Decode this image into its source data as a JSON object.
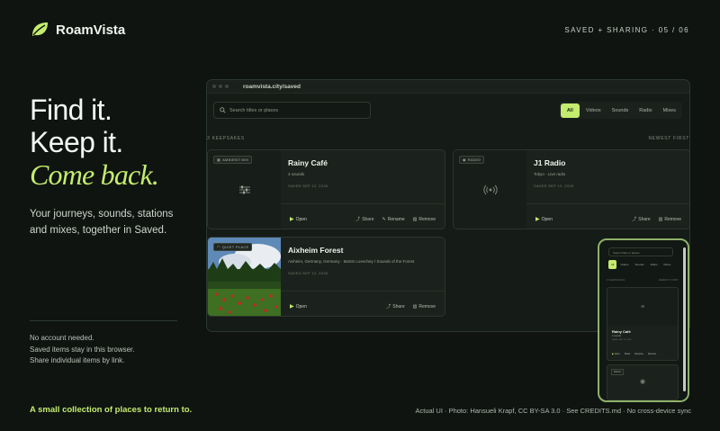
{
  "brand": {
    "name": "RoamVista",
    "color": "#c4ec6e"
  },
  "header": {
    "step": "SAVED + SHARING · 05 / 06"
  },
  "hero": {
    "line1": "Find it.",
    "line2": "Keep it.",
    "line3": "Come back."
  },
  "subtitle": "Your journeys, sounds, stations and mixes, together in Saved.",
  "notes": [
    "No account needed.",
    "Saved items stay in this browser.",
    "Share individual items by link."
  ],
  "tagline": "A small collection of places to return to.",
  "credit": "Actual UI · Photo: Hansueli Krapf, CC BY-SA 3.0 · See CREDITS.md · No cross-device sync",
  "browser": {
    "url": "roamvista.city/saved",
    "search_placeholder": "Search titles or places",
    "filters": [
      "All",
      "Videos",
      "Sounds",
      "Radio",
      "Mixes"
    ],
    "active_filter": "All",
    "count_label": "3 KEEPSAKES",
    "sort_label": "NEWEST FIRST"
  },
  "cards": [
    {
      "badge": "AMBIENT MIX",
      "title": "Rainy Café",
      "meta": "4 sounds",
      "date": "SAVED SEP 12, 2026",
      "open": "Open",
      "actions": [
        "Share",
        "Rename",
        "Remove"
      ]
    },
    {
      "badge": "RADIO",
      "title": "J1 Radio",
      "meta": "Tokyo · Live radio",
      "date": "SAVED SEP 12, 2026",
      "open": "Open",
      "actions": [
        "Share",
        "Remove"
      ]
    },
    {
      "badge": "QUIET PLACE",
      "title": "Aixheim Forest",
      "meta": "Aixheim, Germany, Germany · Martin Loeschey / Sounds of the Forest",
      "date": "SAVED SEP 12, 2026",
      "open": "Open",
      "actions": [
        "Share",
        "Remove"
      ]
    }
  ],
  "phone": {
    "search_placeholder": "Search titles or places",
    "filters": [
      "All",
      "Videos",
      "Sounds",
      "Radio",
      "Mixes"
    ],
    "count_label": "3 KEEPSAKES",
    "sort_label": "NEWEST FIRST",
    "card_title": "Rainy Café",
    "card_meta": "4 sounds",
    "card_date": "SAVED SEP 12, 2026",
    "open": "Open",
    "actions": [
      "Share",
      "Rename",
      "Remove"
    ],
    "badge2": "RADIO"
  }
}
